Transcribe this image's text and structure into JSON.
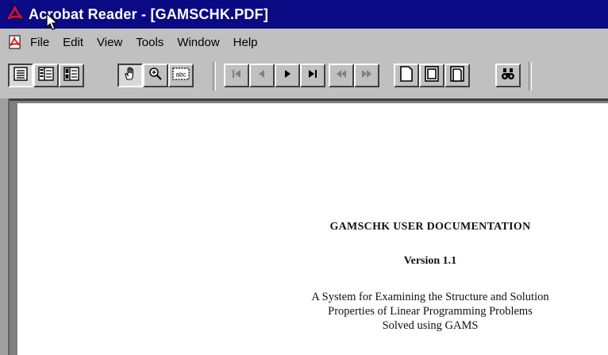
{
  "window": {
    "title": "Acrobat Reader - [GAMSCHK.PDF]"
  },
  "menu": {
    "items": [
      {
        "label": "File"
      },
      {
        "label": "Edit"
      },
      {
        "label": "View"
      },
      {
        "label": "Tools"
      },
      {
        "label": "Window"
      },
      {
        "label": "Help"
      }
    ]
  },
  "toolbar": {
    "buttons": [
      {
        "icon": "page-only-icon"
      },
      {
        "icon": "bookmarks-and-page-icon"
      },
      {
        "icon": "thumbnails-and-page-icon"
      },
      {
        "icon": "hand-tool-icon"
      },
      {
        "icon": "zoom-tool-icon"
      },
      {
        "icon": "select-text-icon"
      },
      {
        "icon": "first-page-icon"
      },
      {
        "icon": "previous-page-icon"
      },
      {
        "icon": "next-page-icon"
      },
      {
        "icon": "last-page-icon"
      },
      {
        "icon": "go-back-icon"
      },
      {
        "icon": "go-forward-icon"
      },
      {
        "icon": "actual-size-icon"
      },
      {
        "icon": "fit-page-icon"
      },
      {
        "icon": "fit-width-icon"
      },
      {
        "icon": "find-icon"
      }
    ]
  },
  "document": {
    "title": "GAMSCHK USER DOCUMENTATION",
    "version": "Version 1.1",
    "subtitle_lines": [
      "A System for Examining the Structure and Solution",
      "Properties of Linear Programming Problems",
      "Solved using GAMS"
    ]
  },
  "colors": {
    "titlebar": "#0a0a84",
    "chrome": "#c0c0c0",
    "page": "#ffffff"
  }
}
